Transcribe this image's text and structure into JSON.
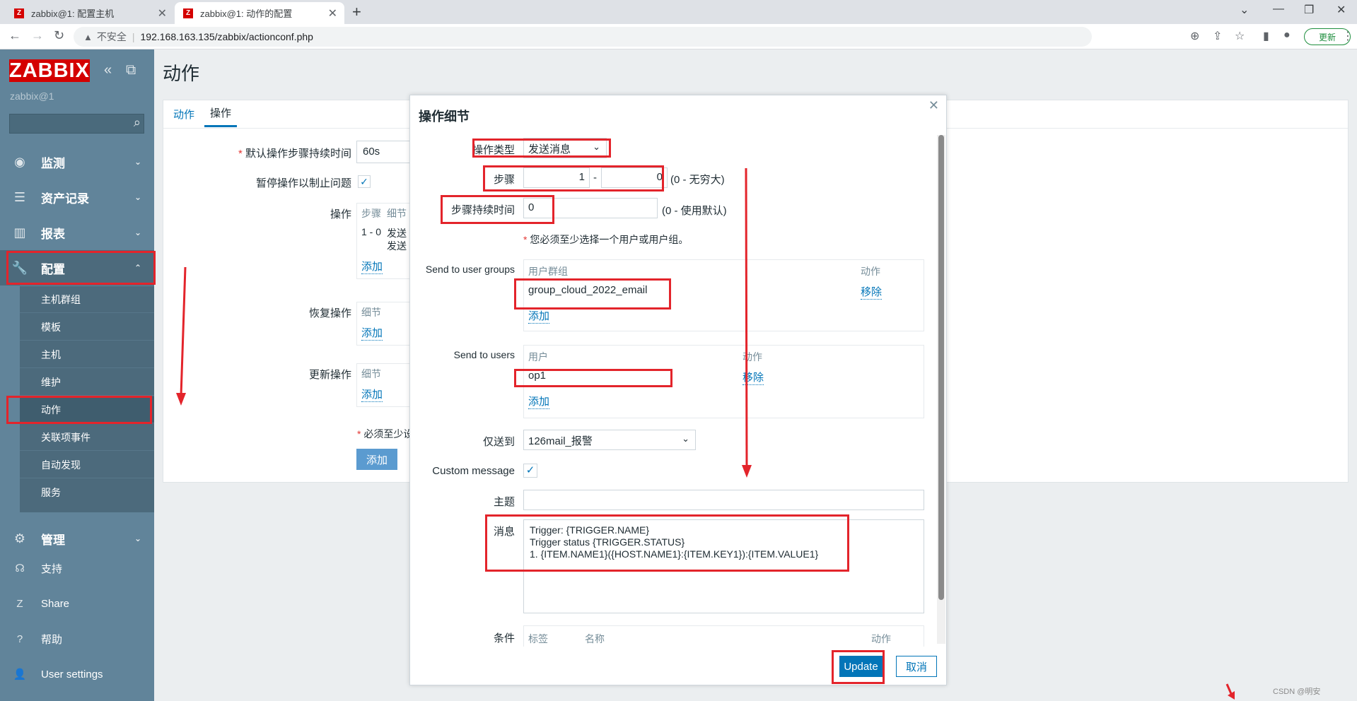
{
  "browser": {
    "tabs": [
      {
        "icon": "Z",
        "title": "zabbix@1: 配置主机"
      },
      {
        "icon": "Z",
        "title": "zabbix@1: 动作的配置"
      }
    ],
    "new_tab": "+",
    "security_label": "不安全",
    "url": "192.168.163.135/zabbix/actionconf.php",
    "update_label": "更新"
  },
  "sidebar": {
    "logo": "ZABBIX",
    "server_name": "zabbix@1",
    "search_placeholder": "",
    "menu": [
      {
        "label": "监测",
        "icon": "eye-icon"
      },
      {
        "label": "资产记录",
        "icon": "list-icon"
      },
      {
        "label": "报表",
        "icon": "chart-icon"
      },
      {
        "label": "配置",
        "icon": "wrench-icon"
      },
      {
        "label": "管理",
        "icon": "gear-icon"
      }
    ],
    "config_submenu": [
      "主机群组",
      "模板",
      "主机",
      "维护",
      "动作",
      "关联项事件",
      "自动发现",
      "服务"
    ],
    "footer": [
      {
        "label": "支持",
        "icon": "headset-icon"
      },
      {
        "label": "Share",
        "icon": "z-icon"
      },
      {
        "label": "帮助",
        "icon": "question-icon"
      },
      {
        "label": "User settings",
        "icon": "user-icon"
      }
    ]
  },
  "page": {
    "title": "动作",
    "tabs": [
      "动作",
      "操作"
    ],
    "default_step_duration_label": "默认操作步骤持续时间",
    "default_step_duration_value": "60s",
    "pause_label": "暂停操作以制止问题",
    "operations_label": "操作",
    "ops_header_steps": "步骤",
    "ops_header_details": "细节",
    "ops_row_steps": "1 - 0",
    "ops_row_detail_1": "发送",
    "ops_row_detail_2": "发送",
    "recovery_label": "恢复操作",
    "update_ops_label": "更新操作",
    "details_header": "细节",
    "add_link": "添加",
    "required_note": "必须至少设",
    "add_button": "添加"
  },
  "dialog": {
    "title": "操作细节",
    "operation_type_label": "操作类型",
    "operation_type_value": "发送消息",
    "steps_label": "步骤",
    "step_from": "1",
    "step_dash": "-",
    "step_to": "0",
    "steps_hint": "(0 - 无穷大)",
    "step_duration_label": "步骤持续时间",
    "step_duration_value": "0",
    "step_duration_hint": "(0 - 使用默认)",
    "required_note": "您必须至少选择一个用户或用户组。",
    "user_groups_label": "Send to user groups",
    "user_groups_col": "用户群组",
    "action_col": "动作",
    "user_group_value": "group_cloud_2022_email",
    "remove_link": "移除",
    "add_link": "添加",
    "users_label": "Send to users",
    "users_col": "用户",
    "user_value": "op1",
    "send_only_to_label": "仅送到",
    "send_only_to_value": "126mail_报警",
    "custom_message_label": "Custom message",
    "subject_label": "主题",
    "subject_value": "",
    "message_label": "消息",
    "message_value": "Trigger: {TRIGGER.NAME}\nTrigger status {TRIGGER.STATUS}\n1. {ITEM.NAME1}({HOST.NAME1}:{ITEM.KEY1}):{ITEM.VALUE1}",
    "conditions_label": "条件",
    "cond_col_label": "标签",
    "cond_col_name": "名称",
    "cond_col_action": "动作",
    "update_button": "Update",
    "cancel_button": "取消"
  },
  "watermark": "CSDN @明安",
  "colors": {
    "accent": "#0275b8",
    "sidebar": "#61849a",
    "logo": "#d40000",
    "annotation": "#e3242b"
  }
}
